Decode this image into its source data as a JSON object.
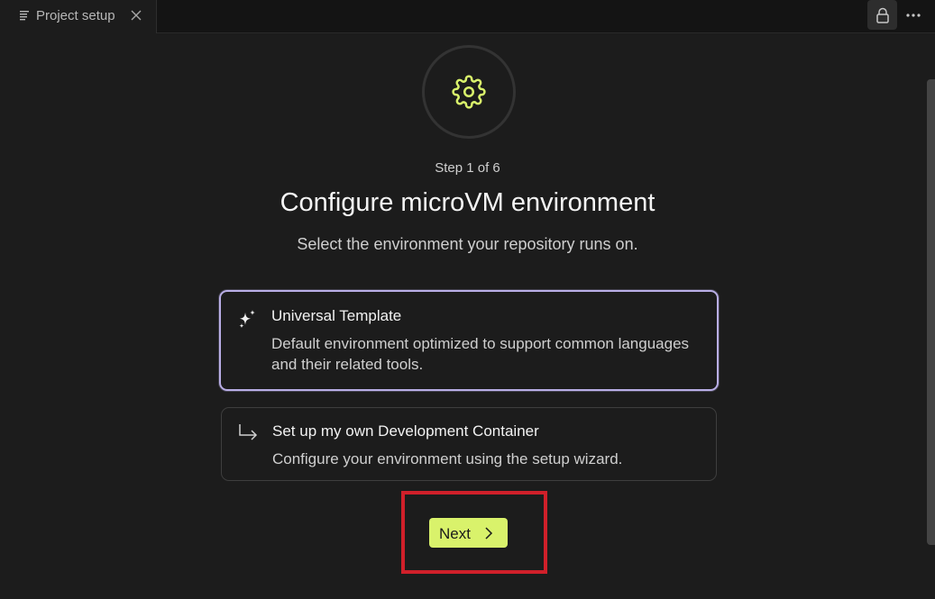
{
  "tab": {
    "label": "Project setup",
    "icon": "document-lines-icon",
    "close_icon": "close-icon"
  },
  "toolbar": {
    "lock_icon": "lock-icon",
    "more_icon": "more-horizontal-icon"
  },
  "header": {
    "icon": "gear-icon",
    "step": "Step 1 of 6",
    "title": "Configure microVM environment",
    "subtitle": "Select the environment your repository runs on."
  },
  "options": [
    {
      "icon": "sparkles-icon",
      "title": "Universal Template",
      "description": "Default environment optimized to support common languages and their related tools.",
      "selected": true
    },
    {
      "icon": "arrow-return-icon",
      "title": "Set up my own Development Container",
      "description": "Configure your environment using the setup wizard.",
      "selected": false
    }
  ],
  "footer": {
    "next_label": "Next",
    "next_icon": "chevron-right-icon"
  },
  "colors": {
    "background": "#1c1c1c",
    "accent": "#d9f26b",
    "selected_border": "#b9aee6",
    "highlight": "#d0202a"
  }
}
